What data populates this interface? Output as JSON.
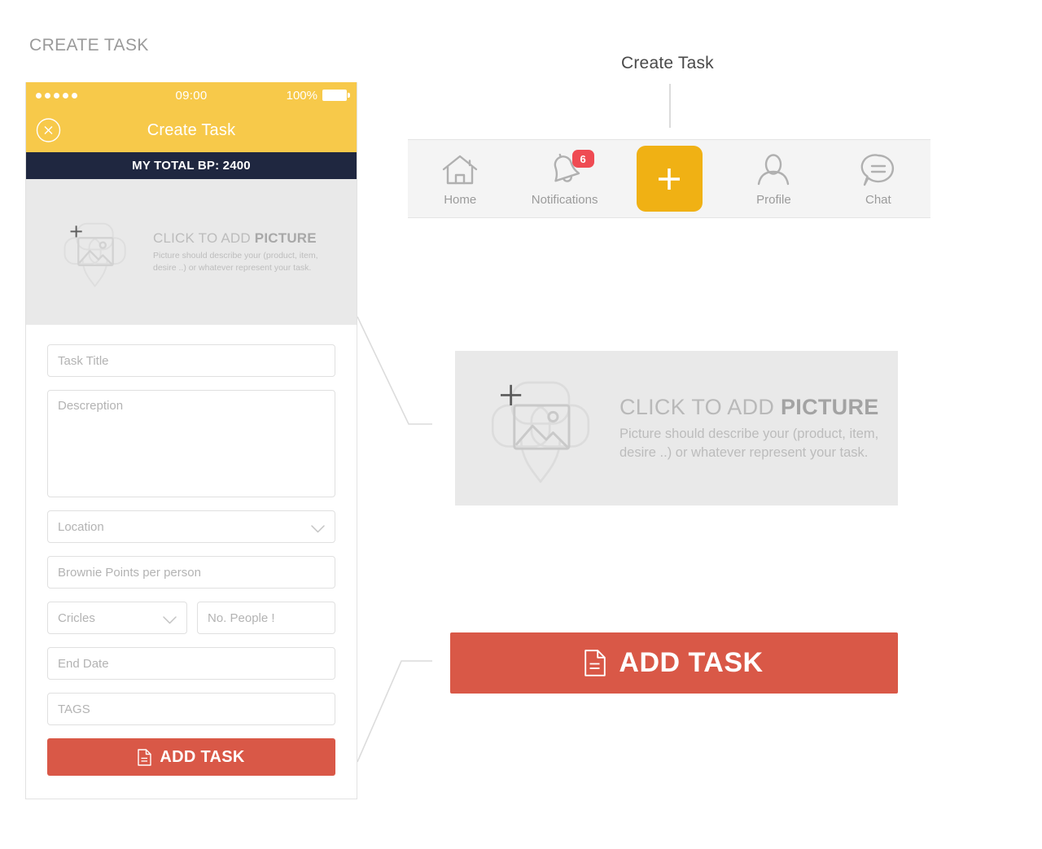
{
  "page": {
    "label": "CREATE TASK"
  },
  "phone": {
    "status_bar": {
      "signal_dots": 5,
      "time": "09:00",
      "battery_percent": "100%",
      "battery_icon": "battery-full-icon"
    },
    "header": {
      "close_icon": "close-circle-icon",
      "title": "Create Task"
    },
    "points_bar": {
      "text": "MY TOTAL BP: 2400"
    },
    "picture_zone": {
      "icon": "add-picture-placeholder-icon",
      "plus_icon": "plus-icon",
      "heading_normal": "CLICK TO ADD ",
      "heading_bold": "PICTURE",
      "subtext_line1": "Picture should describe your (product, item,",
      "subtext_line2": "desire ..) or whatever represent your task."
    },
    "form": {
      "task_title_placeholder": "Task Title",
      "description_placeholder": "Descreption",
      "location_placeholder": "Location",
      "location_chevron_icon": "chevron-down-icon",
      "brownie_points_placeholder": "Brownie Points per person",
      "circles_placeholder": "Cricles",
      "circles_chevron_icon": "chevron-down-icon",
      "people_placeholder": "No. People !",
      "end_date_placeholder": "End Date",
      "tags_placeholder": "TAGS",
      "submit_label": "ADD TASK",
      "submit_icon": "document-icon"
    }
  },
  "callout": {
    "title": "Create Task",
    "tabbar": {
      "items": [
        {
          "label": "Home",
          "icon": "home-icon",
          "badge": ""
        },
        {
          "label": "Notifications",
          "icon": "bell-icon",
          "badge": "6"
        },
        {
          "label": "",
          "icon": "plus-icon",
          "badge": ""
        },
        {
          "label": "Profile",
          "icon": "person-icon",
          "badge": ""
        },
        {
          "label": "Chat",
          "icon": "chat-bubble-icon",
          "badge": ""
        }
      ]
    },
    "picture_zone": {
      "icon": "add-picture-placeholder-icon",
      "plus_icon": "plus-icon",
      "heading_normal": "CLICK TO ADD ",
      "heading_bold": "PICTURE",
      "subtext_line1": "Picture should describe your (product, item,",
      "subtext_line2": "desire ..) or whatever represent your task."
    },
    "add_task_button": {
      "label": "ADD TASK",
      "icon": "document-icon"
    }
  },
  "colors": {
    "brand_yellow": "#F7C94A",
    "accent_amber": "#F0B114",
    "navy": "#1F2740",
    "red": "#D95847",
    "badge_red": "#EF4B53",
    "placeholder_grey": "#E9E9E9",
    "label_grey": "#9A9A9A"
  }
}
